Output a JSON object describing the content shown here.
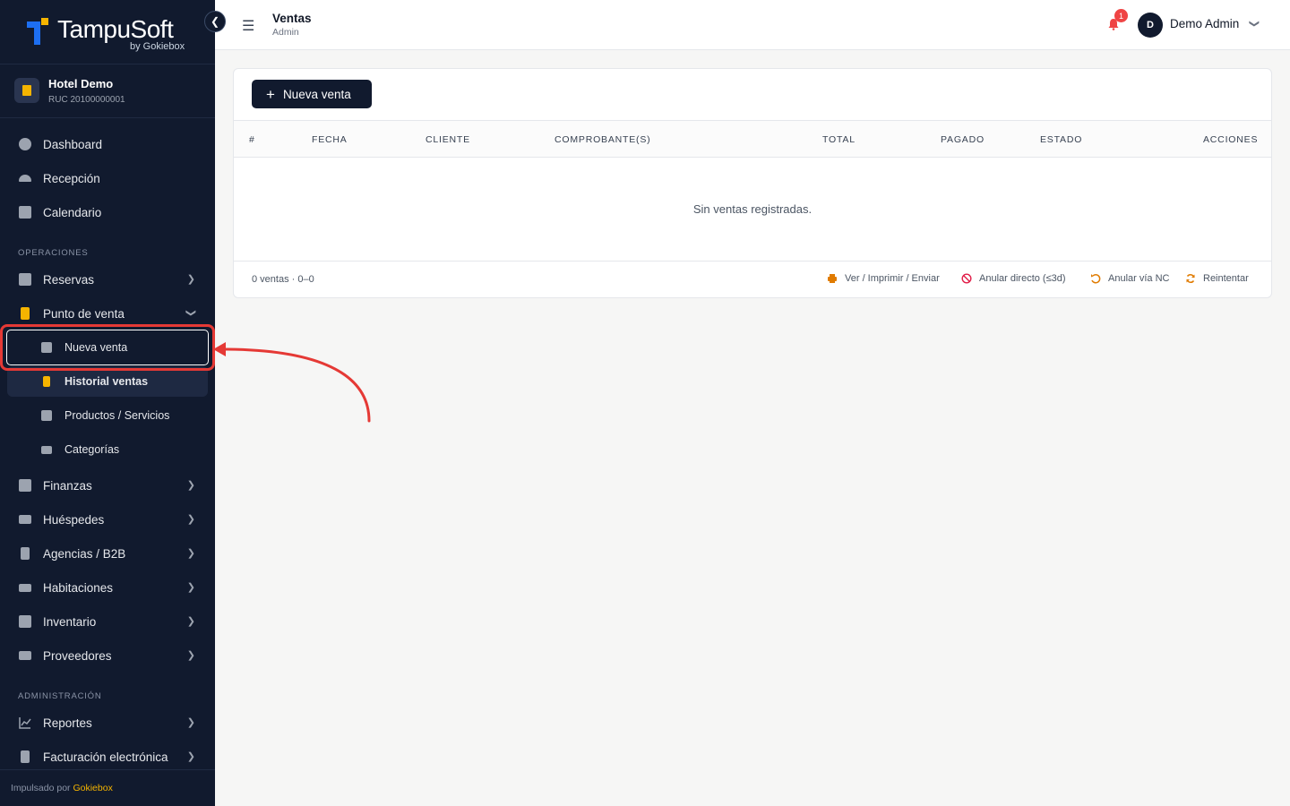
{
  "brand": {
    "name": "TampuSoft",
    "sub": "by Gokiebox"
  },
  "hotel": {
    "name": "Hotel Demo",
    "ruc": "RUC 20100000001"
  },
  "nav": {
    "dashboard": "Dashboard",
    "recepcion": "Recepción",
    "calendario": "Calendario",
    "section_operaciones": "OPERACIONES",
    "reservas": "Reservas",
    "punto_de_venta": "Punto de venta",
    "sub": {
      "nueva_venta": "Nueva venta",
      "historial_ventas": "Historial ventas",
      "productos_servicios": "Productos / Servicios",
      "categorias": "Categorías"
    },
    "finanzas": "Finanzas",
    "huespedes": "Huéspedes",
    "agencias": "Agencias / B2B",
    "habitaciones": "Habitaciones",
    "inventario": "Inventario",
    "proveedores": "Proveedores",
    "section_administracion": "ADMINISTRACIÓN",
    "reportes": "Reportes",
    "facturacion": "Facturación electrónica"
  },
  "powered": {
    "prefix": "Impulsado por",
    "brand": "Gokiebox"
  },
  "header": {
    "title": "Ventas",
    "subtitle": "Admin",
    "notif_count": "1",
    "user_initial": "D",
    "user_name": "Demo Admin"
  },
  "card": {
    "new_button": "Nueva venta",
    "columns": [
      "#",
      "FECHA",
      "CLIENTE",
      "COMPROBANTE(S)",
      "TOTAL",
      "PAGADO",
      "ESTADO",
      "ACCIONES"
    ],
    "empty_message": "Sin ventas registradas.",
    "footer_count": "0 ventas · 0–0",
    "legend": {
      "ver": "Ver / Imprimir / Enviar",
      "anular_directo": "Anular directo (≤3d)",
      "anular_nc": "Anular vía NC",
      "reintentar": "Reintentar"
    }
  },
  "colors": {
    "sidebar_bg": "#111a2e",
    "accent_yellow": "#f5b400",
    "highlight_red": "#e53935",
    "legend_orange": "#e07b00",
    "legend_red": "#e11d48"
  }
}
